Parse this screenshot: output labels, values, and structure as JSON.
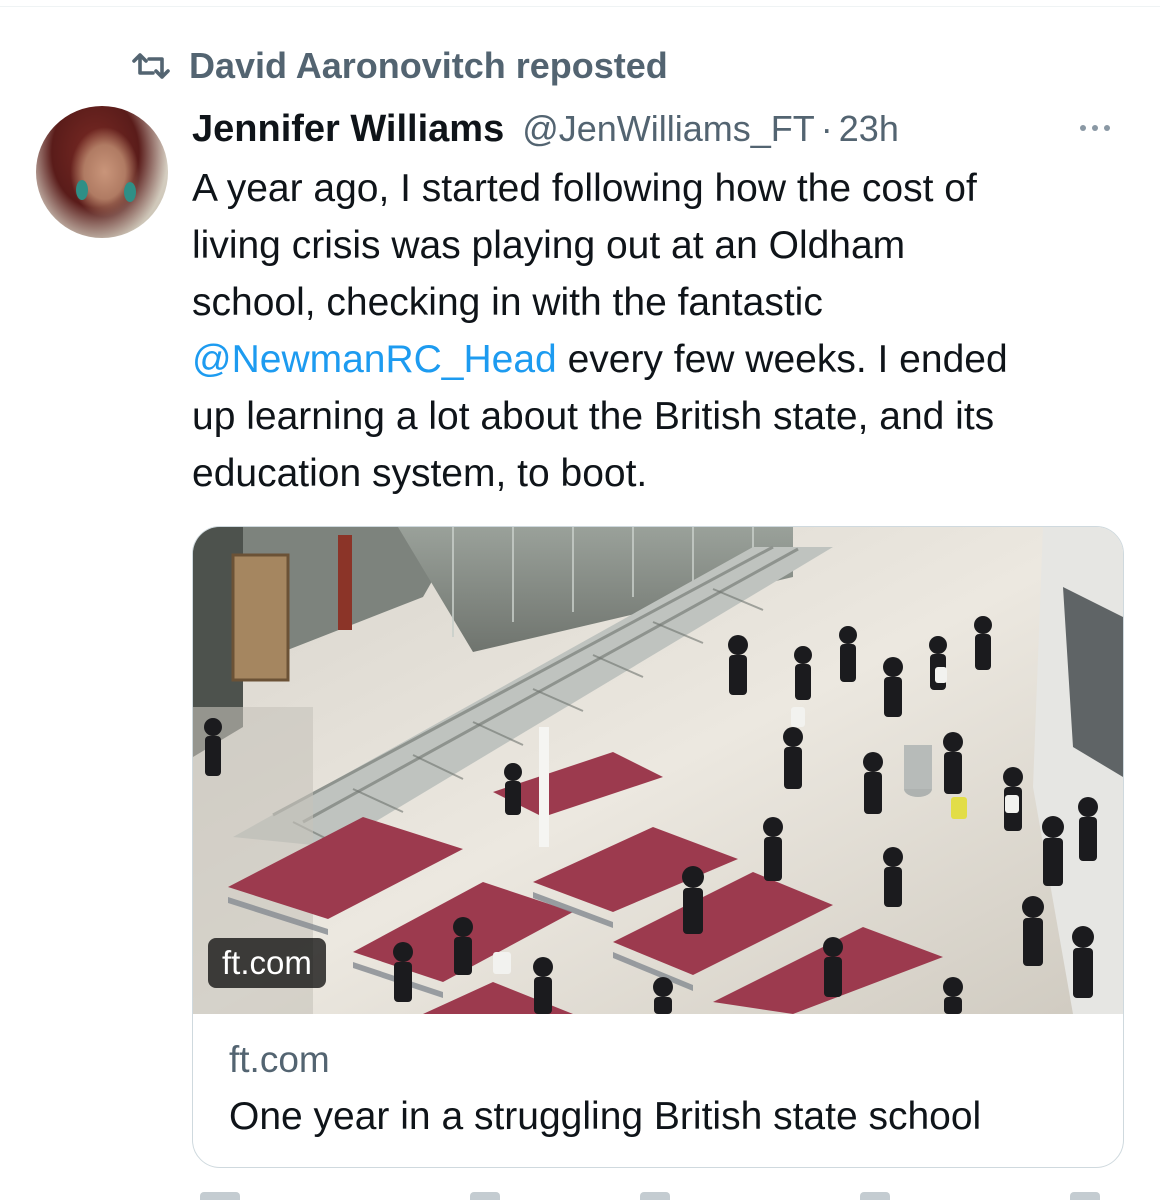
{
  "repost": {
    "icon": "repost-icon",
    "text": "David Aaronovitch reposted"
  },
  "tweet": {
    "author_name": "Jennifer Williams",
    "author_handle": "@JenWilliams_FT",
    "separator": "·",
    "timestamp": "23h",
    "more_icon": "more-options-icon",
    "text": {
      "line1": "A year ago, I started following how the cost of",
      "line2": "living crisis was playing out at an Oldham",
      "line3": "school, checking in with the fantastic",
      "mention": "@NewmanRC_Head",
      "line4_rest": " every few weeks. I ended",
      "line5": "up learning a lot about the British state, and its",
      "line6": "education system, to boot."
    }
  },
  "link_card": {
    "image_badge": "ft.com",
    "domain": "ft.com",
    "title": "One year in a struggling British state school"
  },
  "colors": {
    "text_primary": "#0f1419",
    "text_secondary": "#536471",
    "link": "#1d9bf0",
    "border": "#cfd9de"
  }
}
